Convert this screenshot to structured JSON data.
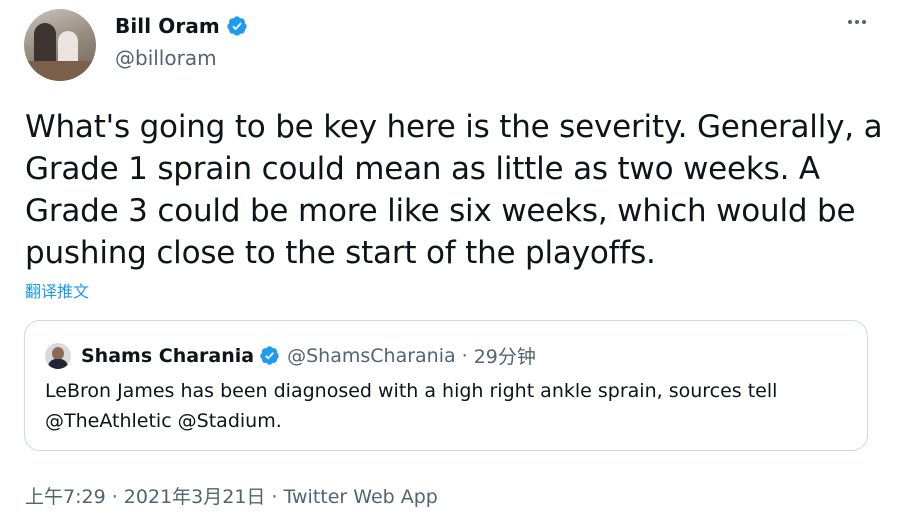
{
  "author": {
    "name": "Bill Oram",
    "handle": "@billoram"
  },
  "tweet": {
    "text": "What's going to be key here is the severity. Generally, a Grade 1 sprain could mean as little as two weeks. A Grade 3 could be more like six weeks, which would be pushing close to the start of the playoffs.",
    "translate_label": "翻译推文"
  },
  "quoted": {
    "name": "Shams Charania",
    "handle": "@ShamsCharania",
    "separator": "·",
    "time": "29分钟",
    "text": "LeBron James has been diagnosed with a high right ankle sprain, sources tell @TheAthletic @Stadium."
  },
  "meta": {
    "time": "上午7:29",
    "sep1": " · ",
    "date": "2021年3月21日",
    "sep2": " · ",
    "source": "Twitter Web App"
  },
  "colors": {
    "accent": "#1d9bf0",
    "verified": "#1d9bf0",
    "secondary_text": "#536471",
    "border": "#cfd9de"
  },
  "icons": {
    "verified": "verified-badge-icon",
    "more": "more-horizontal-icon"
  }
}
